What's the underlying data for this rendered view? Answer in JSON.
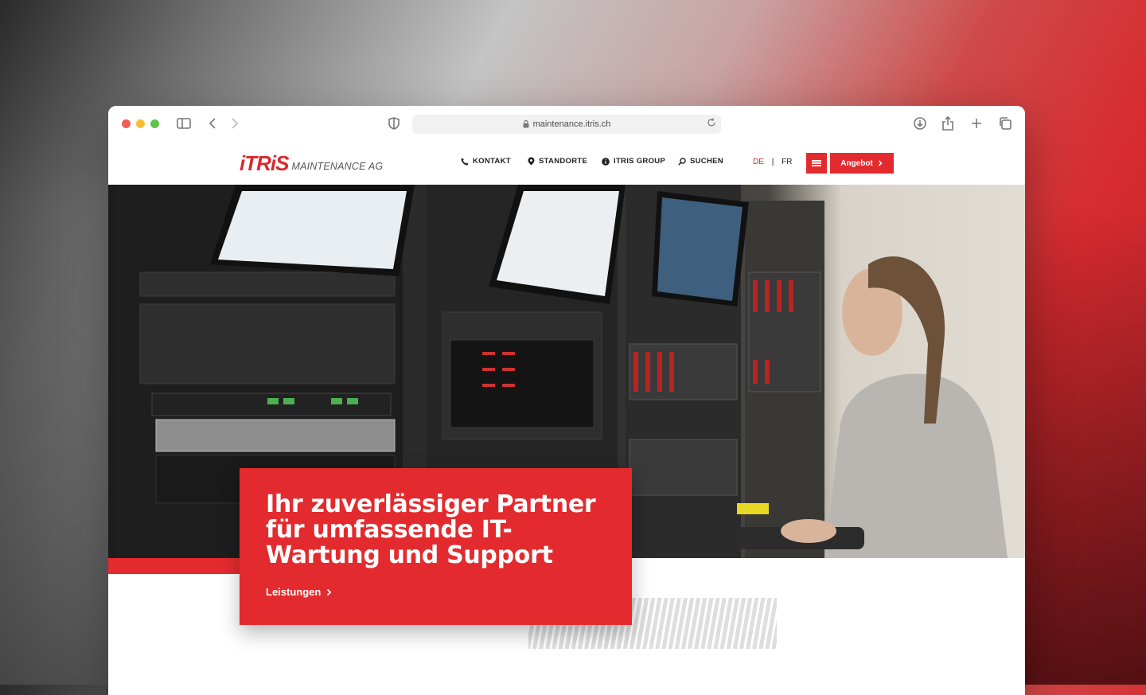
{
  "browser": {
    "url": "maintenance.itris.ch"
  },
  "site": {
    "logo": {
      "mark": "iTRiS",
      "sub": "MAINTENANCE AG"
    },
    "nav": [
      {
        "label": "KONTAKT",
        "icon": "phone-icon"
      },
      {
        "label": "STANDORTE",
        "icon": "location-pin-icon"
      },
      {
        "label": "ITRIS GROUP",
        "icon": "info-icon"
      },
      {
        "label": "SUCHEN",
        "icon": "search-icon"
      }
    ],
    "languages": {
      "de": "DE",
      "separator": "|",
      "fr": "FR",
      "active": "DE"
    },
    "angebot_label": "Angebot",
    "colors": {
      "brand_red": "#e32b2f"
    }
  },
  "hero": {
    "title": "Ihr zuverlässiger Partner für umfassende IT-Wartung und Support",
    "link_label": "Leistungen"
  }
}
